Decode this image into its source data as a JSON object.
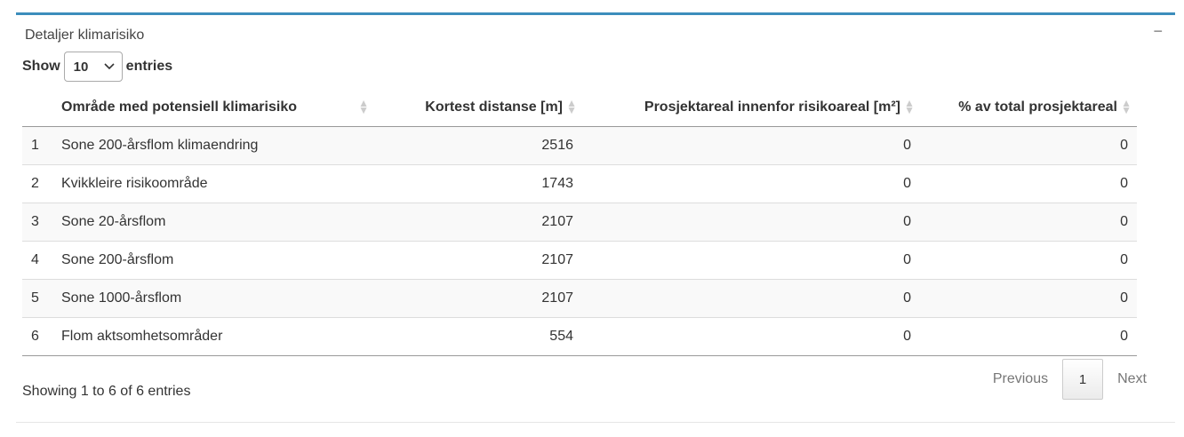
{
  "box": {
    "title": "Detaljer klimarisiko",
    "collapse_symbol": "−"
  },
  "length": {
    "prefix": "Show",
    "value": "10",
    "suffix": "entries",
    "chevron": "chevron-down-icon"
  },
  "table": {
    "headers": [
      "",
      "Område med potensiell klimarisiko",
      "Kortest distanse [m]",
      "Prosjektareal innenfor risikoareal [m²]",
      "% av total prosjektareal"
    ],
    "rows": [
      {
        "idx": "1",
        "name": "Sone 200-årsflom klimaendring",
        "dist": "2516",
        "area": "0",
        "pct": "0"
      },
      {
        "idx": "2",
        "name": "Kvikkleire risikoområde",
        "dist": "1743",
        "area": "0",
        "pct": "0"
      },
      {
        "idx": "3",
        "name": "Sone 20-årsflom",
        "dist": "2107",
        "area": "0",
        "pct": "0"
      },
      {
        "idx": "4",
        "name": "Sone 200-årsflom",
        "dist": "2107",
        "area": "0",
        "pct": "0"
      },
      {
        "idx": "5",
        "name": "Sone 1000-årsflom",
        "dist": "2107",
        "area": "0",
        "pct": "0"
      },
      {
        "idx": "6",
        "name": "Flom aktsomhetsområder",
        "dist": "554",
        "area": "0",
        "pct": "0"
      }
    ]
  },
  "footer": {
    "info": "Showing 1 to 6 of 6 entries",
    "previous": "Previous",
    "current_page": "1",
    "next": "Next"
  },
  "colors": {
    "accent": "#3c8dbc"
  }
}
